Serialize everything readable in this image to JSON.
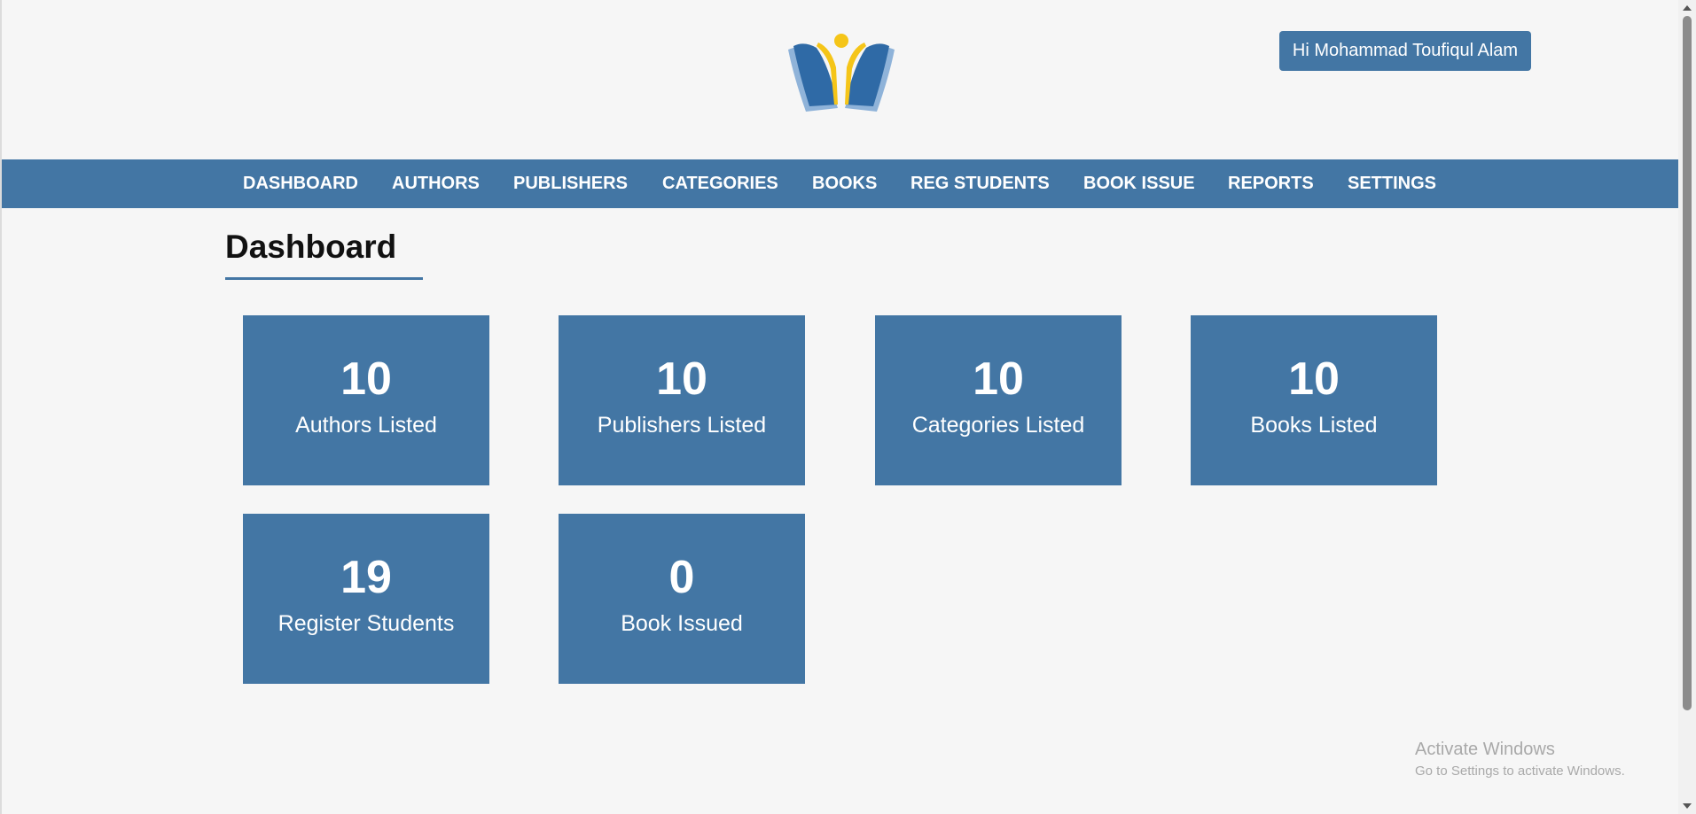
{
  "header": {
    "user_greeting": "Hi Mohammad Toufiqul Alam"
  },
  "nav": {
    "items": [
      "DASHBOARD",
      "AUTHORS",
      "PUBLISHERS",
      "CATEGORIES",
      "BOOKS",
      "REG STUDENTS",
      "BOOK ISSUE",
      "REPORTS",
      "SETTINGS"
    ]
  },
  "page": {
    "title": "Dashboard"
  },
  "cards": [
    {
      "value": "10",
      "label": "Authors Listed"
    },
    {
      "value": "10",
      "label": "Publishers Listed"
    },
    {
      "value": "10",
      "label": "Categories Listed"
    },
    {
      "value": "10",
      "label": "Books Listed"
    },
    {
      "value": "19",
      "label": "Register Students"
    },
    {
      "value": "0",
      "label": "Book Issued"
    }
  ],
  "watermark": {
    "title": "Activate Windows",
    "subtitle": "Go to Settings to activate Windows."
  },
  "colors": {
    "accent": "#4376a4",
    "logo_yellow": "#f5c518",
    "background": "#f6f6f6"
  }
}
